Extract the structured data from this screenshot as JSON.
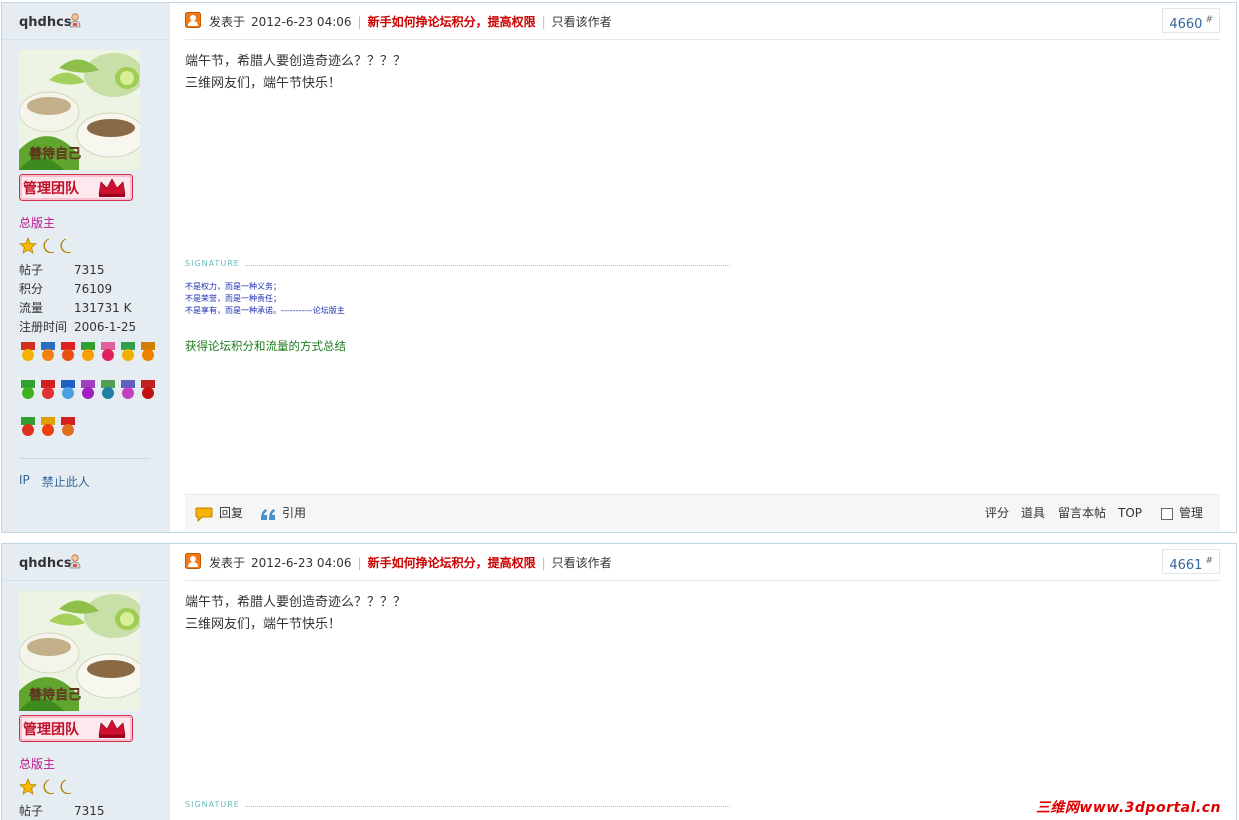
{
  "posts": [
    {
      "author": "qhdhcs",
      "avatar_caption": "善待自己",
      "team_badge": "管理团队",
      "group_title": "总版主",
      "stats": [
        {
          "label": "帖子",
          "value": "7315"
        },
        {
          "label": "积分",
          "value": "76109"
        },
        {
          "label": "流量",
          "value": "131731 K"
        },
        {
          "label": "注册时间",
          "value": "2006-1-25"
        }
      ],
      "side_links": {
        "ip": "IP",
        "ban": "禁止此人"
      },
      "posted_label": "发表于",
      "date": "2012-6-23 04:06",
      "thread_link": "新手如何挣论坛积分，提高权限",
      "only_author": "只看该作者",
      "floor": "4660",
      "floor_mark": "#",
      "body_lines": [
        "端午节，希腊人要创造奇迹么？？？？",
        "三维网友们，端午节快乐！"
      ],
      "signature_label": "SIGNATURE",
      "signature_lines": [
        "不是权力，而是一种义务；",
        "不是荣誉，而是一种责任；",
        "不是享有，而是一种承诺。-----------论坛版主"
      ],
      "howto_link": "获得论坛积分和流量的方式总结",
      "actions": {
        "reply": "回复",
        "quote": "引用",
        "rate": "评分",
        "props": "道具",
        "keep": "留言本帖",
        "top": "TOP",
        "manage": "管理"
      }
    },
    {
      "author": "qhdhcs",
      "avatar_caption": "善待自己",
      "team_badge": "管理团队",
      "group_title": "总版主",
      "stats": [
        {
          "label": "帖子",
          "value": "7315"
        }
      ],
      "posted_label": "发表于",
      "date": "2012-6-23 04:06",
      "thread_link": "新手如何挣论坛积分，提高权限",
      "only_author": "只看该作者",
      "floor": "4661",
      "floor_mark": "#",
      "body_lines": [
        "端午节，希腊人要创造奇迹么？？？？",
        "三维网友们，端午节快乐！"
      ],
      "signature_label": "SIGNATURE"
    }
  ],
  "watermark": "三维网www.3dportal.cn",
  "colors": {
    "sidebar_bg": "#e5edf2",
    "thread_link": "#cc0000",
    "group_title": "#c0158c",
    "howto_link": "#1e7a1e",
    "signature_text": "#1c2bb0",
    "watermark": "#e00000"
  }
}
